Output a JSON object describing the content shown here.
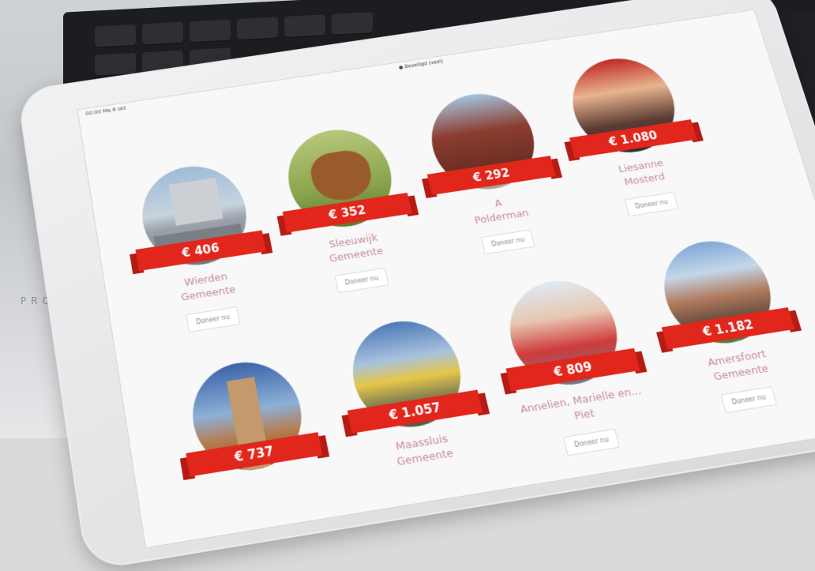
{
  "statusbar": {
    "time": "00:00  Ma 6 okt",
    "site": "● Beveiligd (veel)"
  },
  "laptop": {
    "brand": "PRO"
  },
  "cards": [
    {
      "amount": "€ 406",
      "name_line1": "Wierden",
      "name_line2": "Gemeente",
      "button": "Doneer nu"
    },
    {
      "amount": "€ 352",
      "name_line1": "Sleeuwijk",
      "name_line2": "Gemeente",
      "button": "Doneer nu"
    },
    {
      "amount": "€ 292",
      "name_line1": "A",
      "name_line2": "Polderman",
      "button": "Doneer nu"
    },
    {
      "amount": "€ 1.080",
      "name_line1": "Liesanne",
      "name_line2": "Mosterd",
      "button": "Doneer nu"
    },
    {
      "amount": "€ 737",
      "name_line1": "",
      "name_line2": "",
      "button": ""
    },
    {
      "amount": "€ 1.057",
      "name_line1": "Maassluis",
      "name_line2": "Gemeente",
      "button": ""
    },
    {
      "amount": "€ 809",
      "name_line1": "Annelien, Marielle en...",
      "name_line2": "Piet",
      "button": "Doneer nu"
    },
    {
      "amount": "€ 1.182",
      "name_line1": "Amersfoort",
      "name_line2": "Gemeente",
      "button": "Doneer nu"
    }
  ],
  "colors": {
    "banner": "#e1261c",
    "name_text": "#c98a97"
  }
}
